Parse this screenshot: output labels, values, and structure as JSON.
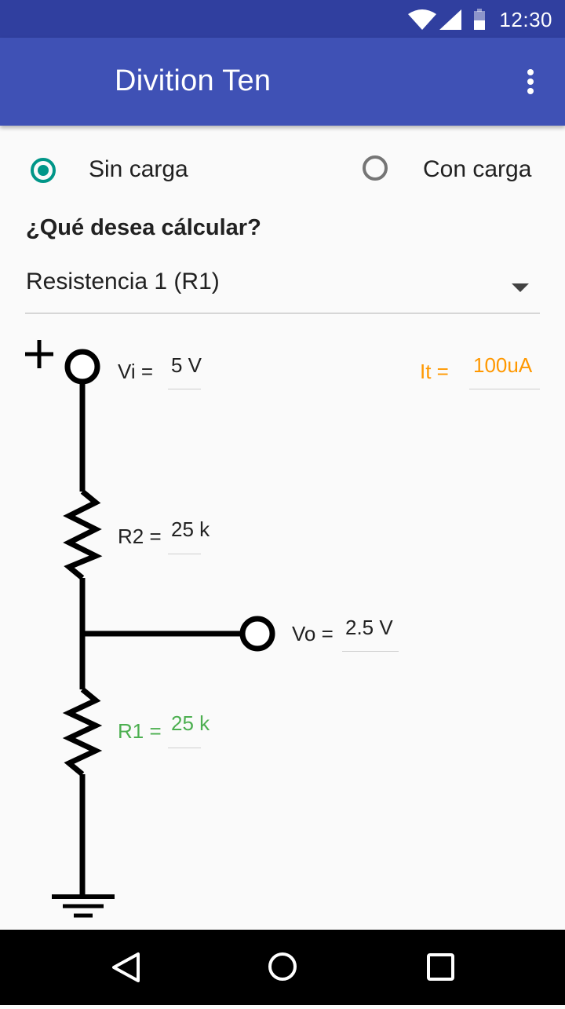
{
  "status_bar": {
    "time": "12:30",
    "icons": [
      "wifi-icon",
      "cell-signal-icon",
      "battery-icon"
    ]
  },
  "app_bar": {
    "title": "Divition Ten",
    "menu_icon": "more-vert-icon",
    "color": "#3f51b5"
  },
  "load_mode": {
    "options": [
      {
        "label": "Sin carga",
        "selected": true
      },
      {
        "label": "Con carga",
        "selected": false
      }
    ]
  },
  "question": "¿Qué desea cálcular?",
  "calculate_select": {
    "selected": "Resistencia 1 (R1)"
  },
  "circuit": {
    "plus_symbol": "+",
    "vi": {
      "label": "Vi =",
      "value": "5 V"
    },
    "it": {
      "label": "It =",
      "value": "100uA",
      "color": "#ff9800"
    },
    "r2": {
      "label": "R2 =",
      "value": "25 k"
    },
    "vo": {
      "label": "Vo =",
      "value": "2.5 V"
    },
    "r1": {
      "label": "R1 =",
      "value": "25 k",
      "color": "#4caf50"
    }
  },
  "nav_bar": {
    "icons": [
      "back-icon",
      "home-icon",
      "recents-icon"
    ]
  }
}
